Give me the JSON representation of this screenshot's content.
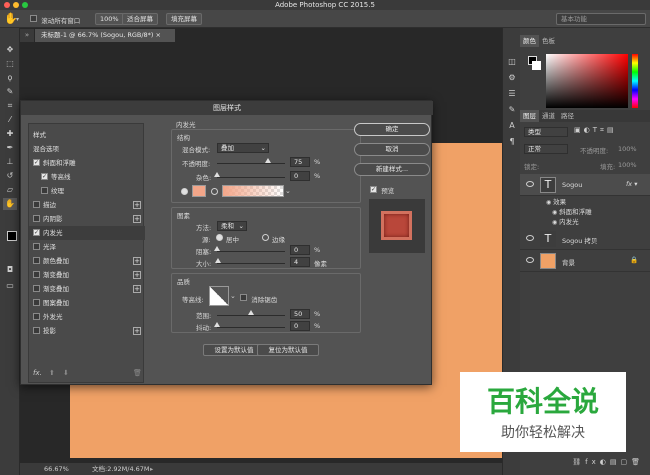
{
  "app_title": "Adobe Photoshop CC 2015.5",
  "options_bar": {
    "scroll_all_label": "滚动所有窗口",
    "zoom_100": "100%",
    "fit_screen": "适合屏幕",
    "fill_screen": "填充屏幕",
    "workspace": "基本功能"
  },
  "document": {
    "tab_title": "未标题-1 @ 66.7% (Sogou, RGB/8*) ×",
    "canvas_color": "#f0a166",
    "zoom": "66.67%",
    "doc_info": "文档:2.92M/4.67M"
  },
  "right_panel": {
    "color_tabs": [
      "颜色",
      "色板"
    ],
    "layer_tabs": [
      "图层",
      "通道",
      "路径"
    ],
    "kind_filter": "类型",
    "blend_mode": "正常",
    "opacity_label": "不透明度:",
    "opacity_value": "100%",
    "lock_label": "锁定:",
    "fill_label": "填充:",
    "fill_value": "100%",
    "layers": [
      {
        "name": "Sogou",
        "type": "text"
      },
      {
        "name": "Sogou 拷贝",
        "type": "text"
      },
      {
        "name": "背景",
        "type": "fill"
      }
    ],
    "effects_label": "效果",
    "effects": [
      "斜面和浮雕",
      "内发光"
    ]
  },
  "dialog": {
    "title": "图层样式",
    "style_list": [
      {
        "label": "样式",
        "checkbox": false,
        "checked": false,
        "plus": false
      },
      {
        "label": "混合选项",
        "checkbox": false,
        "checked": false,
        "plus": false
      },
      {
        "label": "斜面和浮雕",
        "checkbox": true,
        "checked": true,
        "plus": false
      },
      {
        "label": "等高线",
        "checkbox": true,
        "checked": true,
        "plus": false,
        "indent": true
      },
      {
        "label": "纹理",
        "checkbox": true,
        "checked": false,
        "plus": false,
        "indent": true
      },
      {
        "label": "描边",
        "checkbox": true,
        "checked": false,
        "plus": true
      },
      {
        "label": "内阴影",
        "checkbox": true,
        "checked": false,
        "plus": true
      },
      {
        "label": "内发光",
        "checkbox": true,
        "checked": true,
        "plus": false,
        "selected": true
      },
      {
        "label": "光泽",
        "checkbox": true,
        "checked": false,
        "plus": false
      },
      {
        "label": "颜色叠加",
        "checkbox": true,
        "checked": false,
        "plus": true
      },
      {
        "label": "渐变叠加",
        "checkbox": true,
        "checked": false,
        "plus": true
      },
      {
        "label": "渐变叠加",
        "checkbox": true,
        "checked": false,
        "plus": true
      },
      {
        "label": "图案叠加",
        "checkbox": true,
        "checked": false,
        "plus": false
      },
      {
        "label": "外发光",
        "checkbox": true,
        "checked": false,
        "plus": false
      },
      {
        "label": "投影",
        "checkbox": true,
        "checked": false,
        "plus": true
      }
    ],
    "fx_label": "fx.",
    "section_title": "内发光",
    "structure_label": "结构",
    "blend_mode_label": "混合模式:",
    "blend_mode_value": "叠加",
    "opacity_label": "不透明度:",
    "opacity_value": "75",
    "noise_label": "杂色:",
    "noise_value": "0",
    "pct": "%",
    "elements_label": "图素",
    "method_label": "方法:",
    "method_value": "柔和",
    "source_label": "源:",
    "source_center": "居中",
    "source_edge": "边缘",
    "choke_label": "阻塞:",
    "choke_value": "0",
    "size_label": "大小:",
    "size_value": "4",
    "px": "像素",
    "quality_label": "品质",
    "contour_label": "等高线:",
    "antialias_label": "消除锯齿",
    "range_label": "范围:",
    "range_value": "50",
    "jitter_label": "抖动:",
    "jitter_value": "0",
    "default_set": "设置为默认值",
    "default_reset": "复位为默认值",
    "ok": "确定",
    "cancel": "取消",
    "new_style": "新建样式...",
    "preview": "预览",
    "glow_color": "#f3a689"
  },
  "watermark": {
    "line1": "百科全说",
    "line2": "助你轻松解决"
  }
}
